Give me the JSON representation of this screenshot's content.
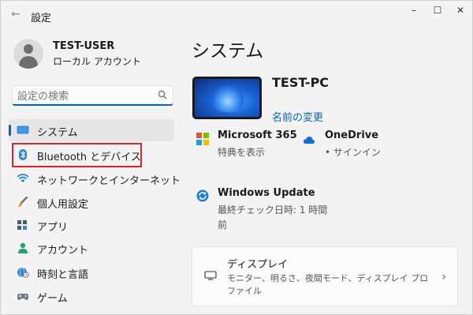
{
  "window": {
    "title": "設定",
    "controls": {
      "minimize": "–",
      "maximize": "☐",
      "close": "✕"
    }
  },
  "user": {
    "name": "TEST-USER",
    "account_type": "ローカル アカウント"
  },
  "search": {
    "placeholder": "設定の検索",
    "value": ""
  },
  "sidebar": {
    "items": [
      {
        "label": "システム",
        "icon": "monitor-icon",
        "active": true
      },
      {
        "label": "Bluetooth とデバイス",
        "icon": "bluetooth-icon",
        "active": false,
        "highlighted": true
      },
      {
        "label": "ネットワークとインターネット",
        "icon": "wifi-icon",
        "active": false
      },
      {
        "label": "個人用設定",
        "icon": "brush-icon",
        "active": false
      },
      {
        "label": "アプリ",
        "icon": "apps-icon",
        "active": false
      },
      {
        "label": "アカウント",
        "icon": "person-icon",
        "active": false
      },
      {
        "label": "時刻と言語",
        "icon": "globe-clock-icon",
        "active": false
      },
      {
        "label": "ゲーム",
        "icon": "gamepad-icon",
        "active": false
      }
    ]
  },
  "main": {
    "title": "システム",
    "device": {
      "name": "TEST-PC",
      "rename_link": "名前の変更"
    },
    "tiles": {
      "microsoft365": {
        "title": "Microsoft 365",
        "subtitle": "特典を表示"
      },
      "onedrive": {
        "title": "OneDrive",
        "subtitle": "• サインイン"
      },
      "windows_update": {
        "title": "Windows Update",
        "subtitle_line1": "最終チェック日時: 1 時間",
        "subtitle_line2": "前"
      }
    },
    "display_card": {
      "title": "ディスプレイ",
      "subtitle": "モニター、明るさ、夜間モード、ディスプレイ プロファイル",
      "chevron": "›"
    }
  },
  "colors": {
    "accent": "#0067c0",
    "highlight_box": "#e3222a",
    "window_bg": "#f3f3f3"
  }
}
